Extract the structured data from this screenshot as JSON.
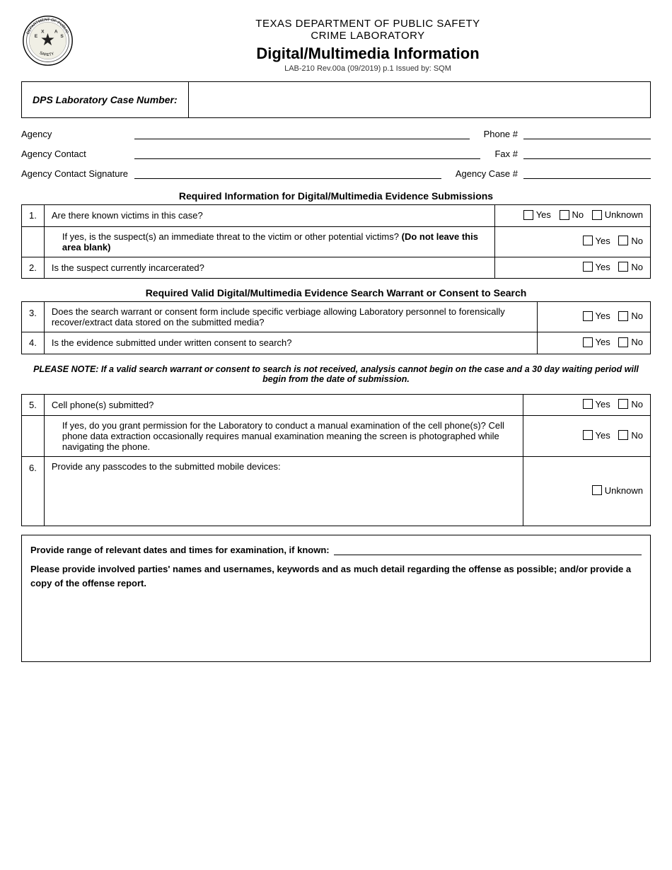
{
  "header": {
    "dept_line1": "TEXAS DEPARTMENT OF PUBLIC SAFETY",
    "dept_line2": "CRIME LABORATORY",
    "form_title": "Digital/Multimedia Information",
    "form_sub": "LAB-210 Rev.00a (09/2019) p.1 Issued by: SQM"
  },
  "case_number": {
    "label": "DPS Laboratory Case Number:"
  },
  "fields": {
    "agency_label": "Agency",
    "phone_label": "Phone #",
    "agency_contact_label": "Agency Contact",
    "fax_label": "Fax #",
    "agency_contact_sig_label": "Agency Contact Signature",
    "agency_case_label": "Agency Case #"
  },
  "section1": {
    "title": "Required Information for Digital/Multimedia Evidence Submissions",
    "questions": [
      {
        "num": "1.",
        "text": "Are there known victims in this case?",
        "options": [
          "Yes",
          "No",
          "Unknown"
        ]
      },
      {
        "num": "",
        "text": "If yes, is the suspect(s) an immediate threat to the victim or other potential victims? (Do not leave this area blank)",
        "options": [
          "Yes",
          "No"
        ],
        "bold_part": "(Do not leave this area blank)"
      },
      {
        "num": "2.",
        "text": "Is the suspect currently incarcerated?",
        "options": [
          "Yes",
          "No"
        ]
      }
    ]
  },
  "section2": {
    "title": "Required Valid Digital/Multimedia Evidence Search Warrant or Consent to Search",
    "questions": [
      {
        "num": "3.",
        "text": "Does the search warrant or consent form include specific verbiage allowing Laboratory personnel to forensically recover/extract data stored on the submitted media?",
        "options": [
          "Yes",
          "No"
        ]
      },
      {
        "num": "4.",
        "text": "Is the evidence submitted under written consent to search?",
        "options": [
          "Yes",
          "No"
        ]
      }
    ]
  },
  "please_note": "PLEASE NOTE:  If a valid search warrant or consent to search is not received, analysis cannot begin on the case and a 30 day waiting period will begin from the date of submission.",
  "section3": {
    "questions": [
      {
        "num": "5.",
        "text": "Cell phone(s) submitted?",
        "options": [
          "Yes",
          "No"
        ]
      },
      {
        "num": "",
        "text": "If yes, do you grant permission for the Laboratory to conduct a manual examination of the cell phone(s)? Cell phone data extraction occasionally requires manual examination meaning the screen is photographed while navigating the phone.",
        "options": [
          "Yes",
          "No"
        ]
      },
      {
        "num": "6.",
        "text": "Provide any passcodes to the submitted mobile devices:",
        "options": [
          "Unknown"
        ]
      }
    ]
  },
  "bottom": {
    "dates_label": "Provide range of relevant dates and times for examination, if known:",
    "detail_text": "Please provide involved parties' names and usernames, keywords and as much detail regarding the offense as possible; and/or provide a copy of the offense report."
  },
  "logo": {
    "star_char": "★",
    "arc_top": "DEPARTMENT OF PUBLIC",
    "arc_bottom": "SAFETY"
  }
}
